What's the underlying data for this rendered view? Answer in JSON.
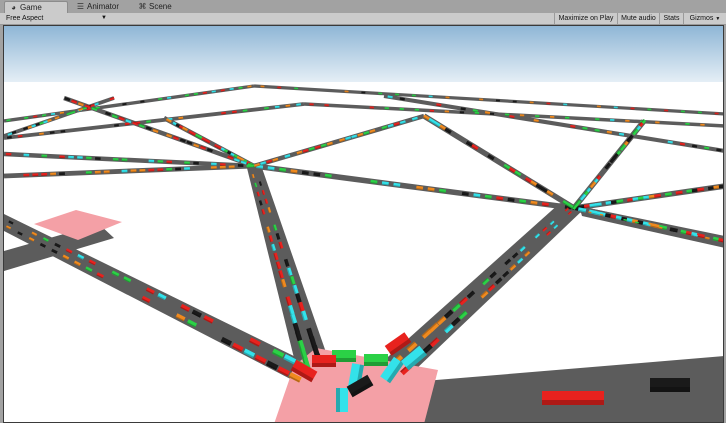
{
  "tabs": [
    {
      "label": "Game",
      "icon": "pacman-icon",
      "active": true
    },
    {
      "label": "Animator",
      "icon": "animator-icon",
      "active": false
    },
    {
      "label": "Scene",
      "icon": "scene-grid-icon",
      "active": false
    }
  ],
  "toolbar": {
    "aspect": "Free Aspect",
    "maximize_on_play": "Maximize on Play",
    "mute_audio": "Mute audio",
    "stats": "Stats",
    "gizmos": "Gizmos"
  },
  "colors": {
    "sky_top": "#8fb6d6",
    "sky_bottom": "#eef4f9",
    "ground": "#ffffff",
    "road": "#5c5c5c",
    "intersection": "#f4a0a6",
    "car_colors": [
      "#e8221e",
      "#33e2ea",
      "#2bd146",
      "#f08a1e",
      "#1a1a1a"
    ]
  }
}
